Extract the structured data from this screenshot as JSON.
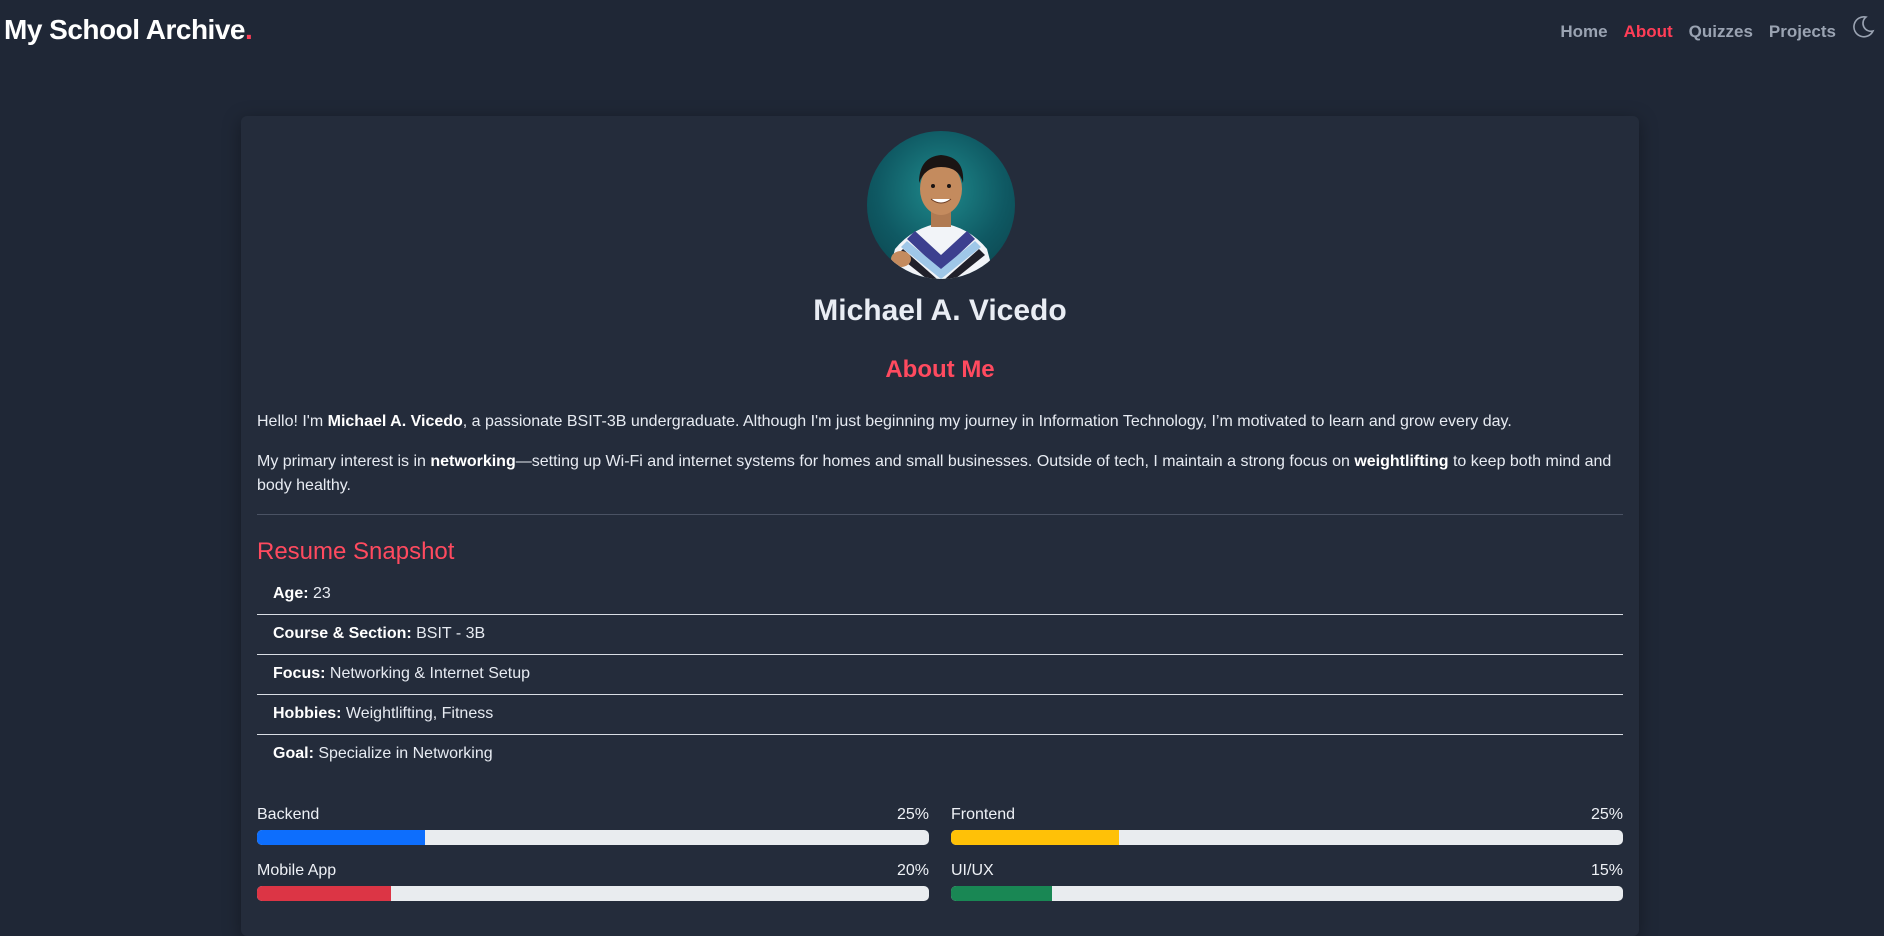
{
  "navbar": {
    "brand": "My School Archive",
    "brand_dot": ".",
    "links": [
      {
        "label": "Home"
      },
      {
        "label": "About"
      },
      {
        "label": "Quizzes"
      },
      {
        "label": "Projects"
      }
    ],
    "active": "About",
    "theme_icon": "moon-icon"
  },
  "profile": {
    "name": "Michael A. Vicedo",
    "about_title": "About Me",
    "para1": {
      "pre": "Hello! I'm ",
      "bold": "Michael A. Vicedo",
      "post": ", a passionate BSIT-3B undergraduate. Although I'm just beginning my journey in Information Technology, I’m motivated to learn and grow every day."
    },
    "para2": {
      "pre": "My primary interest is in ",
      "bold1": "networking",
      "mid": "—setting up Wi-Fi and internet systems for homes and small businesses. Outside of tech, I maintain a strong focus on ",
      "bold2": "weightlifting",
      "post": " to keep both mind and body healthy."
    }
  },
  "resume": {
    "title": "Resume Snapshot",
    "items": [
      {
        "label": "Age:",
        "value": " 23"
      },
      {
        "label": "Course & Section:",
        "value": " BSIT - 3B"
      },
      {
        "label": "Focus:",
        "value": " Networking & Internet Setup"
      },
      {
        "label": "Hobbies:",
        "value": " Weightlifting, Fitness"
      },
      {
        "label": "Goal:",
        "value": " Specialize in Networking"
      }
    ]
  },
  "skills": [
    {
      "name": "Backend",
      "percent_label": "25%",
      "percent": 25,
      "color": "#0d6efd"
    },
    {
      "name": "Frontend",
      "percent_label": "25%",
      "percent": 25,
      "color": "#ffc107"
    },
    {
      "name": "Mobile App",
      "percent_label": "20%",
      "percent": 20,
      "color": "#dc3545"
    },
    {
      "name": "UI/UX",
      "percent_label": "15%",
      "percent": 15,
      "color": "#198754"
    }
  ],
  "colors": {
    "accent": "#ff4a5f",
    "background": "#1f2736",
    "card": "#242c3b"
  }
}
